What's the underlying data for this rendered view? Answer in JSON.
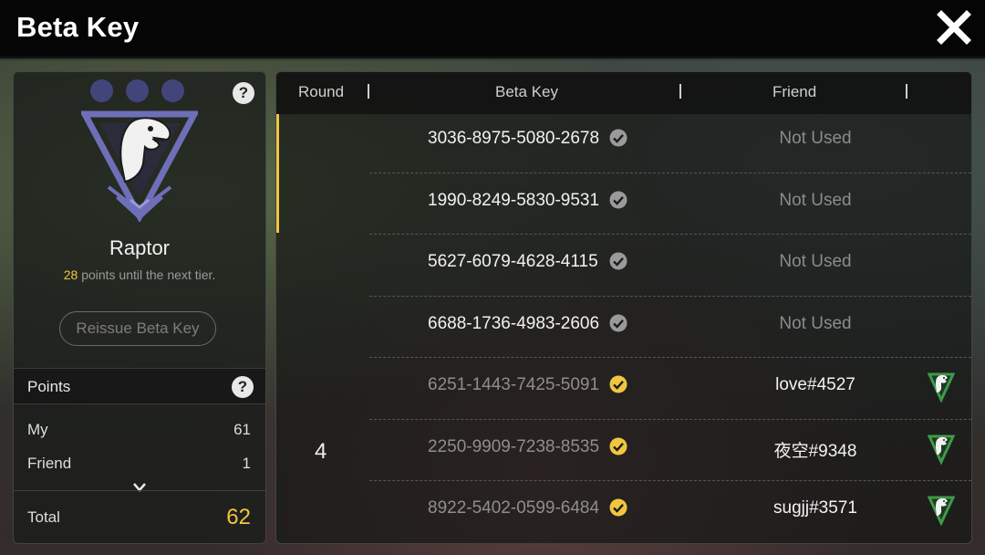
{
  "header": {
    "title": "Beta Key"
  },
  "tier": {
    "name": "Raptor",
    "points_needed": "28",
    "points_suffix": "points until the next tier."
  },
  "reissue_label": "Reissue Beta Key",
  "points": {
    "label": "Points",
    "my_label": "My",
    "my_value": "61",
    "friend_label": "Friend",
    "friend_value": "1",
    "total_label": "Total",
    "total_value": "62"
  },
  "table": {
    "headers": {
      "round": "Round",
      "key": "Beta Key",
      "friend": "Friend"
    },
    "round_number": "4",
    "rows": [
      {
        "key": "3036-8975-5080-2678",
        "friend": "Not Used",
        "used": false
      },
      {
        "key": "1990-8249-5830-9531",
        "friend": "Not Used",
        "used": false
      },
      {
        "key": "5627-6079-4628-4115",
        "friend": "Not Used",
        "used": false
      },
      {
        "key": "6688-1736-4983-2606",
        "friend": "Not Used",
        "used": false
      },
      {
        "key": "6251-1443-7425-5091",
        "friend": "love#4527",
        "used": true
      },
      {
        "key": "2250-9909-7238-8535",
        "friend": "夜空#9348",
        "used": true
      },
      {
        "key": "8922-5402-0599-6484",
        "friend": "sugjj#3571",
        "used": true
      }
    ]
  },
  "colors": {
    "accent_gold": "#f0c63f",
    "tier_purple": "#6e6fb8",
    "badge_green": "#3f9a4a"
  },
  "icons": [
    "close-icon",
    "help-icon",
    "raptor-emblem-icon",
    "check-circle-icon",
    "chevron-down-icon",
    "raptor-badge-icon"
  ]
}
